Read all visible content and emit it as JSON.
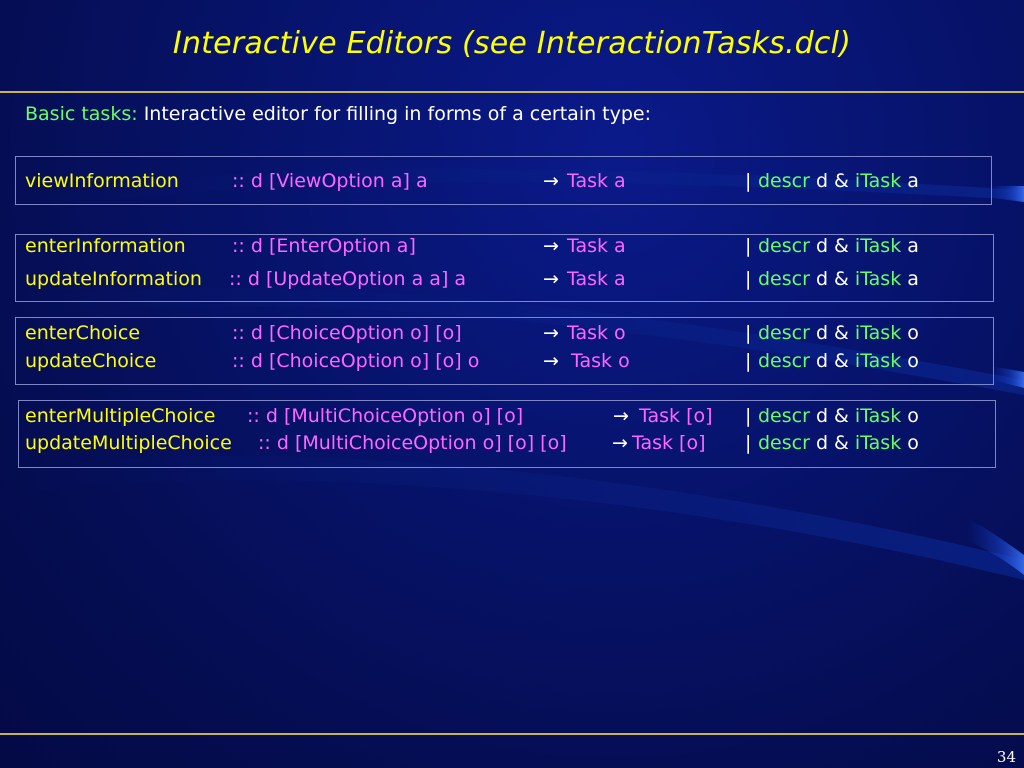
{
  "slide": {
    "title": "Interactive Editors (see InteractionTasks.dcl)",
    "subtitle_prefix": "Basic tasks",
    "subtitle_colon": ":",
    "subtitle_rest": " Interactive  editor for filling in forms of a certain type:",
    "page_number": "34"
  },
  "groups": [
    {
      "rows": [
        {
          "name": "viewInformation",
          "sig": ":: d [ViewOption a] a",
          "arrow": "→",
          "task": "Task a",
          "bar": "|",
          "descr": "descr",
          "d_amp": " d & ",
          "itask": "iTask",
          "var": " a"
        }
      ]
    },
    {
      "rows": [
        {
          "name": "enterInformation",
          "sig": ":: d [EnterOption a]",
          "arrow": "→",
          "task": "Task a",
          "bar": "|",
          "descr": "descr",
          "d_amp": " d & ",
          "itask": "iTask",
          "var": " a"
        },
        {
          "name": "updateInformation",
          "sig": ":: d [UpdateOption a a] a",
          "arrow": "→",
          "task": "Task a",
          "bar": "|",
          "descr": "descr",
          "d_amp": " d & ",
          "itask": "iTask",
          "var": " a"
        }
      ]
    },
    {
      "rows": [
        {
          "name": "enterChoice",
          "sig": ":: d [ChoiceOption o] [o]",
          "arrow": "→",
          "task": "Task o",
          "bar": "|",
          "descr": "descr",
          "d_amp": " d & ",
          "itask": "iTask",
          "var": " o"
        },
        {
          "name": "updateChoice",
          "sig": ":: d [ChoiceOption o] [o] o",
          "arrow": "→",
          "task": " Task o",
          "bar": "|",
          "descr": "descr",
          "d_amp": " d & ",
          "itask": "iTask",
          "var": " o"
        }
      ]
    },
    {
      "rows": [
        {
          "name": "enterMultipleChoice",
          "sig": ":: d [MultiChoiceOption o] [o]",
          "arrow": "→",
          "task": " Task [o]",
          "bar": "|",
          "descr": "descr",
          "d_amp": " d & ",
          "itask": "iTask",
          "var": " o"
        },
        {
          "name": "updateMultipleChoice",
          "sig": ":: d [MultiChoiceOption o] [o] [o]",
          "arrow": "→",
          "task": "Task [o]",
          "bar": "|",
          "descr": "descr",
          "d_amp": " d & ",
          "itask": "iTask",
          "var": " o"
        }
      ]
    }
  ]
}
